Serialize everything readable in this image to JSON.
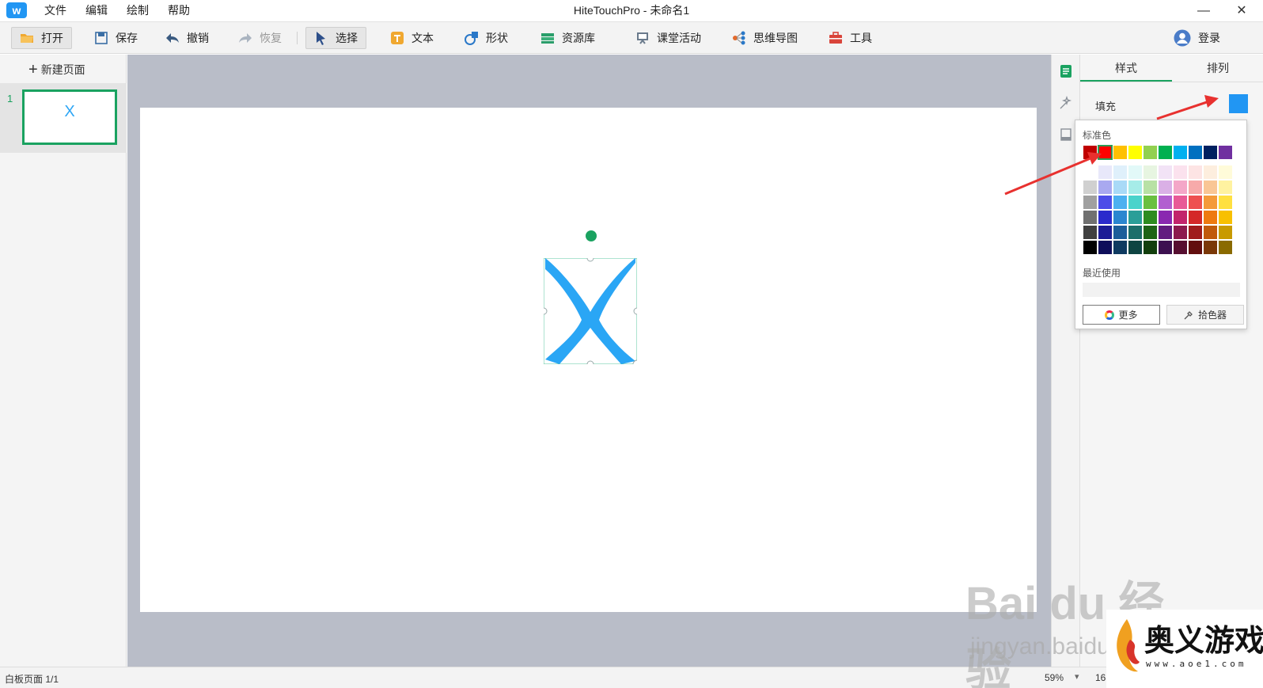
{
  "titlebar": {
    "logo": "w",
    "menu": [
      "文件",
      "编辑",
      "绘制",
      "帮助"
    ],
    "title": "HiteTouchPro - 未命名1",
    "minimize": "—",
    "close": "✕"
  },
  "toolbar": {
    "open": "打开",
    "save": "保存",
    "undo": "撤销",
    "redo": "恢复",
    "select": "选择",
    "text": "文本",
    "shape": "形状",
    "resources": "资源库",
    "classroom": "课堂活动",
    "mindmap": "思维导图",
    "tools": "工具",
    "login": "登录",
    "icons": [
      "folder-icon",
      "save-icon",
      "undo-icon",
      "redo-icon",
      "cursor-icon",
      "text-icon",
      "shape-icon",
      "resource-icon",
      "classroom-icon",
      "mindmap-icon",
      "toolbox-icon",
      "user-icon"
    ]
  },
  "left_panel": {
    "new_page": "新建页面",
    "pages": [
      {
        "number": "1",
        "thumb_text": "X"
      }
    ]
  },
  "right_panel": {
    "tabs": [
      "样式",
      "排列"
    ],
    "fill_label": "填充",
    "fill_color": "#2196f3"
  },
  "color_picker": {
    "standard_label": "标准色",
    "standard_colors": [
      "#c00000",
      "#ff0000",
      "#ffc000",
      "#ffff00",
      "#92d050",
      "#00b050",
      "#00b0f0",
      "#0070c0",
      "#002060",
      "#7030a0"
    ],
    "selected_standard_index": 1,
    "palette": [
      [
        "#ffffff",
        "#e8e8fa",
        "#dff0fb",
        "#e2f9f8",
        "#e7f5e1",
        "#f2e3f6",
        "#fbe2ee",
        "#fde4e4",
        "#fdeede",
        "#fffbd9"
      ],
      [
        "#d0d0d0",
        "#a9a9f0",
        "#a9daf7",
        "#a6ece8",
        "#b8e1a5",
        "#dab0e6",
        "#f4a7c8",
        "#f7aaaa",
        "#f9c695",
        "#fff2a0"
      ],
      [
        "#a0a0a0",
        "#4d4de8",
        "#4cb0f0",
        "#4ad3cb",
        "#6ac040",
        "#b25fd0",
        "#e85a97",
        "#ee5050",
        "#f49a3a",
        "#ffe040"
      ],
      [
        "#707070",
        "#2a2acc",
        "#2a86d0",
        "#2a9e98",
        "#2e8c20",
        "#8a28b0",
        "#c2246c",
        "#d42828",
        "#ee7a10",
        "#f8c000"
      ],
      [
        "#404040",
        "#1c1c96",
        "#1c5e9a",
        "#1c6e6a",
        "#1e6416",
        "#621c80",
        "#8c1a4e",
        "#a01c1c",
        "#c05a0c",
        "#c89a00"
      ],
      [
        "#000000",
        "#0e0e5a",
        "#0e3a60",
        "#0e4442",
        "#123e0c",
        "#3c1050",
        "#560e30",
        "#620e0e",
        "#7a3808",
        "#8a6a00"
      ]
    ],
    "recent_label": "最近使用",
    "more_label": "更多",
    "picker_label": "拾色器"
  },
  "statusbar": {
    "left": "白板页面 1/1",
    "zoom": "59%",
    "right": "16"
  },
  "watermarks": {
    "baidu": "Bai du 经验",
    "baidu_sub": "jingyan.baidu",
    "aoyi_title": "奥义游戏网",
    "aoyi_url": "www.aoe1.com"
  },
  "colors": {
    "accent": "#1aa260",
    "selection": "#5bc7a0",
    "shape_fill": "#2aa6f5",
    "arrow": "#e8312f"
  }
}
